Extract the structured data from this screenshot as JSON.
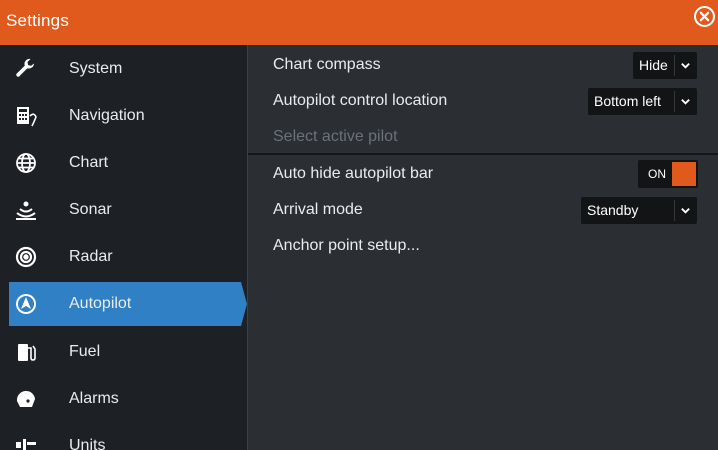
{
  "window": {
    "title": "Settings"
  },
  "sidebar": {
    "items": [
      {
        "label": "System",
        "icon": "wrench-icon"
      },
      {
        "label": "Navigation",
        "icon": "navigation-icon"
      },
      {
        "label": "Chart",
        "icon": "globe-icon"
      },
      {
        "label": "Sonar",
        "icon": "sonar-icon"
      },
      {
        "label": "Radar",
        "icon": "radar-icon"
      },
      {
        "label": "Autopilot",
        "icon": "autopilot-icon",
        "active": true
      },
      {
        "label": "Fuel",
        "icon": "fuel-icon"
      },
      {
        "label": "Alarms",
        "icon": "alarm-icon"
      },
      {
        "label": "Units",
        "icon": "units-icon"
      }
    ]
  },
  "settings": {
    "chart_compass": {
      "label": "Chart compass",
      "value": "Hide"
    },
    "autopilot_control_location": {
      "label": "Autopilot control location",
      "value": "Bottom left"
    },
    "select_active_pilot": {
      "label": "Select active pilot",
      "enabled": false
    },
    "auto_hide_autopilot_bar": {
      "label": "Auto hide autopilot bar",
      "value": "ON"
    },
    "arrival_mode": {
      "label": "Arrival mode",
      "value": "Standby"
    },
    "anchor_point_setup": {
      "label": "Anchor point setup..."
    }
  },
  "colors": {
    "accent": "#e05a1e",
    "active_item": "#2f80c5",
    "sidebar_bg": "#1d2024",
    "panel_bg": "#2b2f33"
  }
}
